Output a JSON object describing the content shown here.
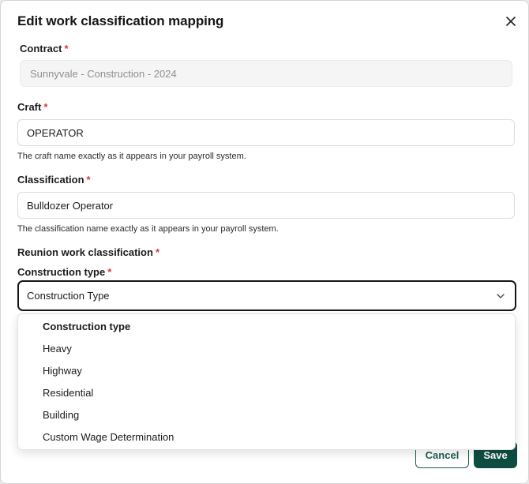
{
  "dialog": {
    "title": "Edit work classification mapping",
    "close_icon": "close-icon"
  },
  "contract": {
    "label": "Contract",
    "required_mark": "*",
    "value": "Sunnyvale - Construction - 2024"
  },
  "craft": {
    "label": "Craft",
    "required_mark": "*",
    "value": "OPERATOR",
    "help": "The craft name exactly as it appears in your payroll system."
  },
  "classification": {
    "label": "Classification",
    "required_mark": "*",
    "value": "Bulldozer Operator",
    "help": "The classification name exactly as it appears in your payroll system."
  },
  "reunion": {
    "label": "Reunion work classification",
    "required_mark": "*"
  },
  "construction_type": {
    "label": "Construction type",
    "required_mark": "*",
    "selected": "Construction Type",
    "options_header": "Construction type",
    "options": [
      "Heavy",
      "Highway",
      "Residential",
      "Building",
      "Custom Wage Determination"
    ]
  },
  "actions": {
    "cancel": "Cancel",
    "save": "Save"
  },
  "colors": {
    "primary": "#0e4d42",
    "required": "#d23b3b"
  }
}
